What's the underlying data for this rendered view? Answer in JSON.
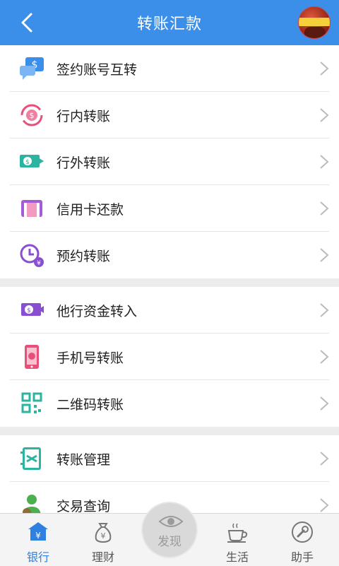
{
  "header": {
    "title": "转账汇款"
  },
  "groups": [
    {
      "items": [
        {
          "label": "签约账号互转",
          "icon": "signed-account-transfer-icon",
          "color": "#3b8fe8"
        },
        {
          "label": "行内转账",
          "icon": "intra-bank-transfer-icon",
          "color": "#e8507a"
        },
        {
          "label": "行外转账",
          "icon": "inter-bank-transfer-icon",
          "color": "#2bb5a0"
        },
        {
          "label": "信用卡还款",
          "icon": "credit-card-repayment-icon",
          "color": "#a55bd6"
        },
        {
          "label": "预约转账",
          "icon": "scheduled-transfer-icon",
          "color": "#8a4fd0"
        }
      ]
    },
    {
      "items": [
        {
          "label": "他行资金转入",
          "icon": "other-bank-funds-in-icon",
          "color": "#8a4fd0"
        },
        {
          "label": "手机号转账",
          "icon": "phone-number-transfer-icon",
          "color": "#e8507a"
        },
        {
          "label": "二维码转账",
          "icon": "qr-code-transfer-icon",
          "color": "#2bb5a0"
        }
      ]
    },
    {
      "items": [
        {
          "label": "转账管理",
          "icon": "transfer-management-icon",
          "color": "#2bb5a0"
        },
        {
          "label": "交易查询",
          "icon": "transaction-query-icon",
          "color": "#4caf50"
        }
      ]
    }
  ],
  "tabs": [
    {
      "label": "银行",
      "icon": "bank-icon",
      "active": true
    },
    {
      "label": "理财",
      "icon": "money-bag-icon",
      "active": false
    },
    {
      "label": "发现",
      "icon": "eye-icon",
      "active": false
    },
    {
      "label": "生活",
      "icon": "coffee-cup-icon",
      "active": false
    },
    {
      "label": "助手",
      "icon": "wrench-icon",
      "active": false
    }
  ],
  "colors": {
    "header": "#3b8fe8",
    "active_tab": "#2f80e0",
    "inactive_tab": "#555555"
  }
}
